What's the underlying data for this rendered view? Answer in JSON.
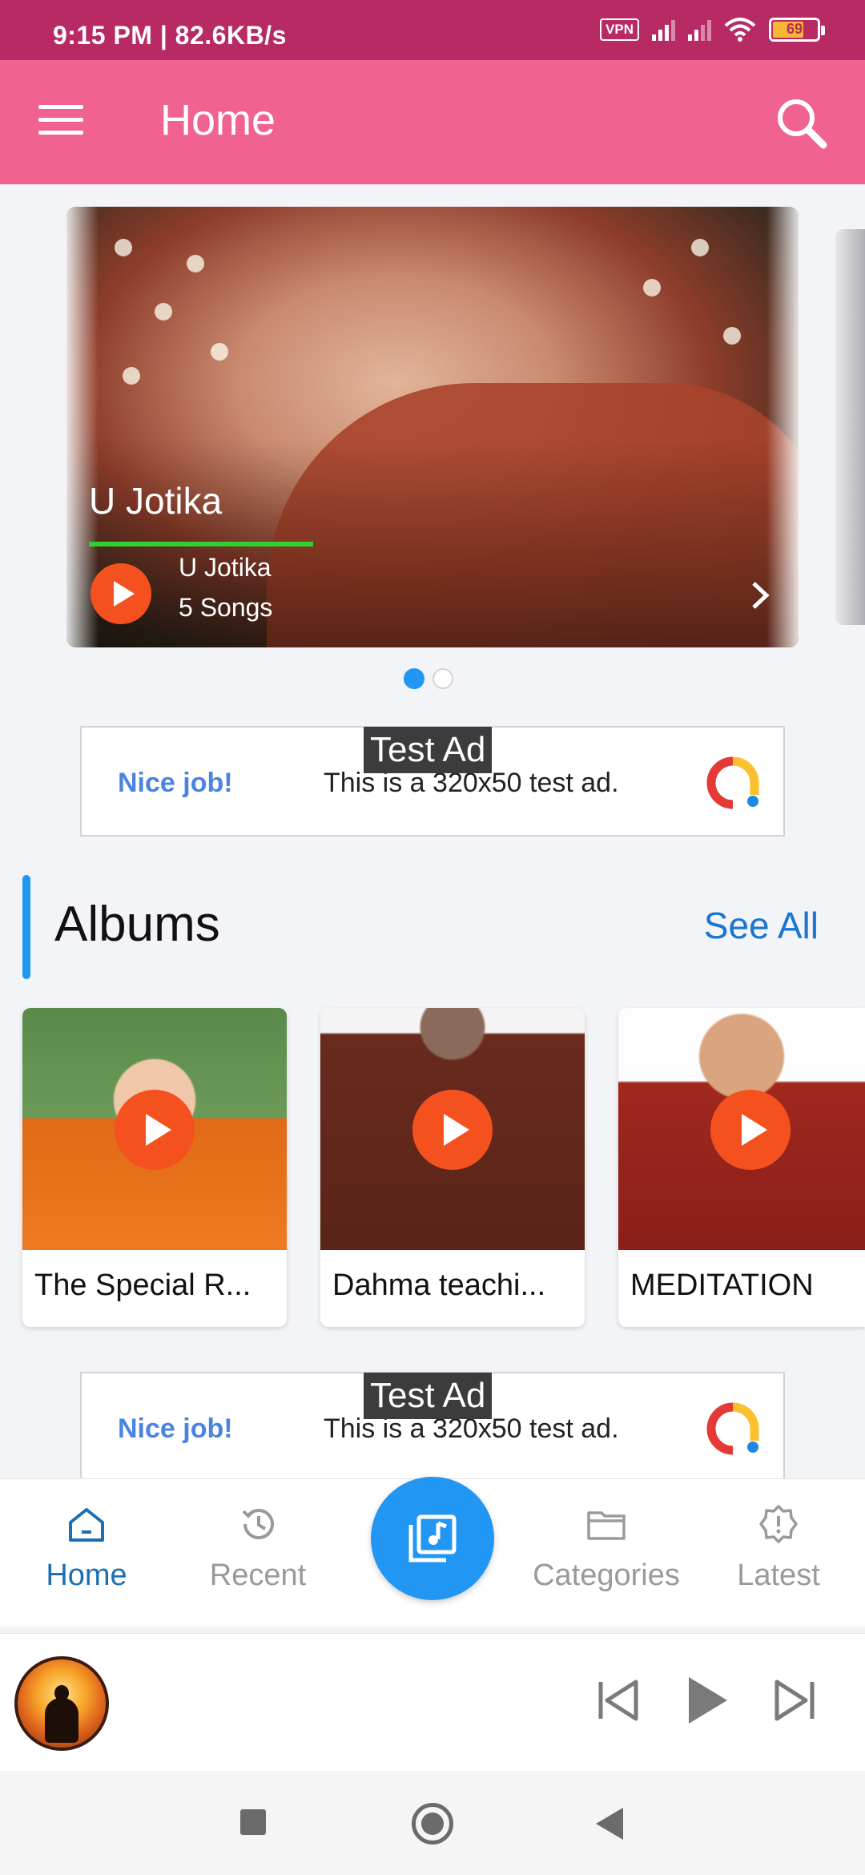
{
  "status_bar": {
    "time": "9:15 PM | 82.6KB/s",
    "vpn": "VPN",
    "battery": "69"
  },
  "app_bar": {
    "title": "Home"
  },
  "carousel": {
    "slide": {
      "title": "U Jotika",
      "artist": "U Jotika",
      "count": "5 Songs"
    },
    "page_count": 2,
    "active_page": 1
  },
  "ads": [
    {
      "label": "Test Ad",
      "headline": "Nice job!",
      "body": "This is a 320x50 test ad."
    },
    {
      "label": "Test Ad",
      "headline": "Nice job!",
      "body": "This is a 320x50 test ad."
    }
  ],
  "albums_section": {
    "title": "Albums",
    "see_all": "See All",
    "items": [
      {
        "name": "The Special R..."
      },
      {
        "name": "Dahma teachi..."
      },
      {
        "name": "MEDITATION"
      }
    ]
  },
  "bottom_nav": {
    "items": [
      {
        "label": "Home",
        "icon": "home-icon",
        "active": true
      },
      {
        "label": "Recent",
        "icon": "history-icon",
        "active": false
      },
      {
        "label": "Categories",
        "icon": "folder-icon",
        "active": false
      },
      {
        "label": "Latest",
        "icon": "badge-alert-icon",
        "active": false
      }
    ],
    "center_icon": "music-library-icon"
  },
  "colors": {
    "status_bar": "#b72a63",
    "app_bar": "#f0628f",
    "accent": "#2196f3",
    "play": "#f4511e",
    "nav_active": "#1d6fb3"
  }
}
